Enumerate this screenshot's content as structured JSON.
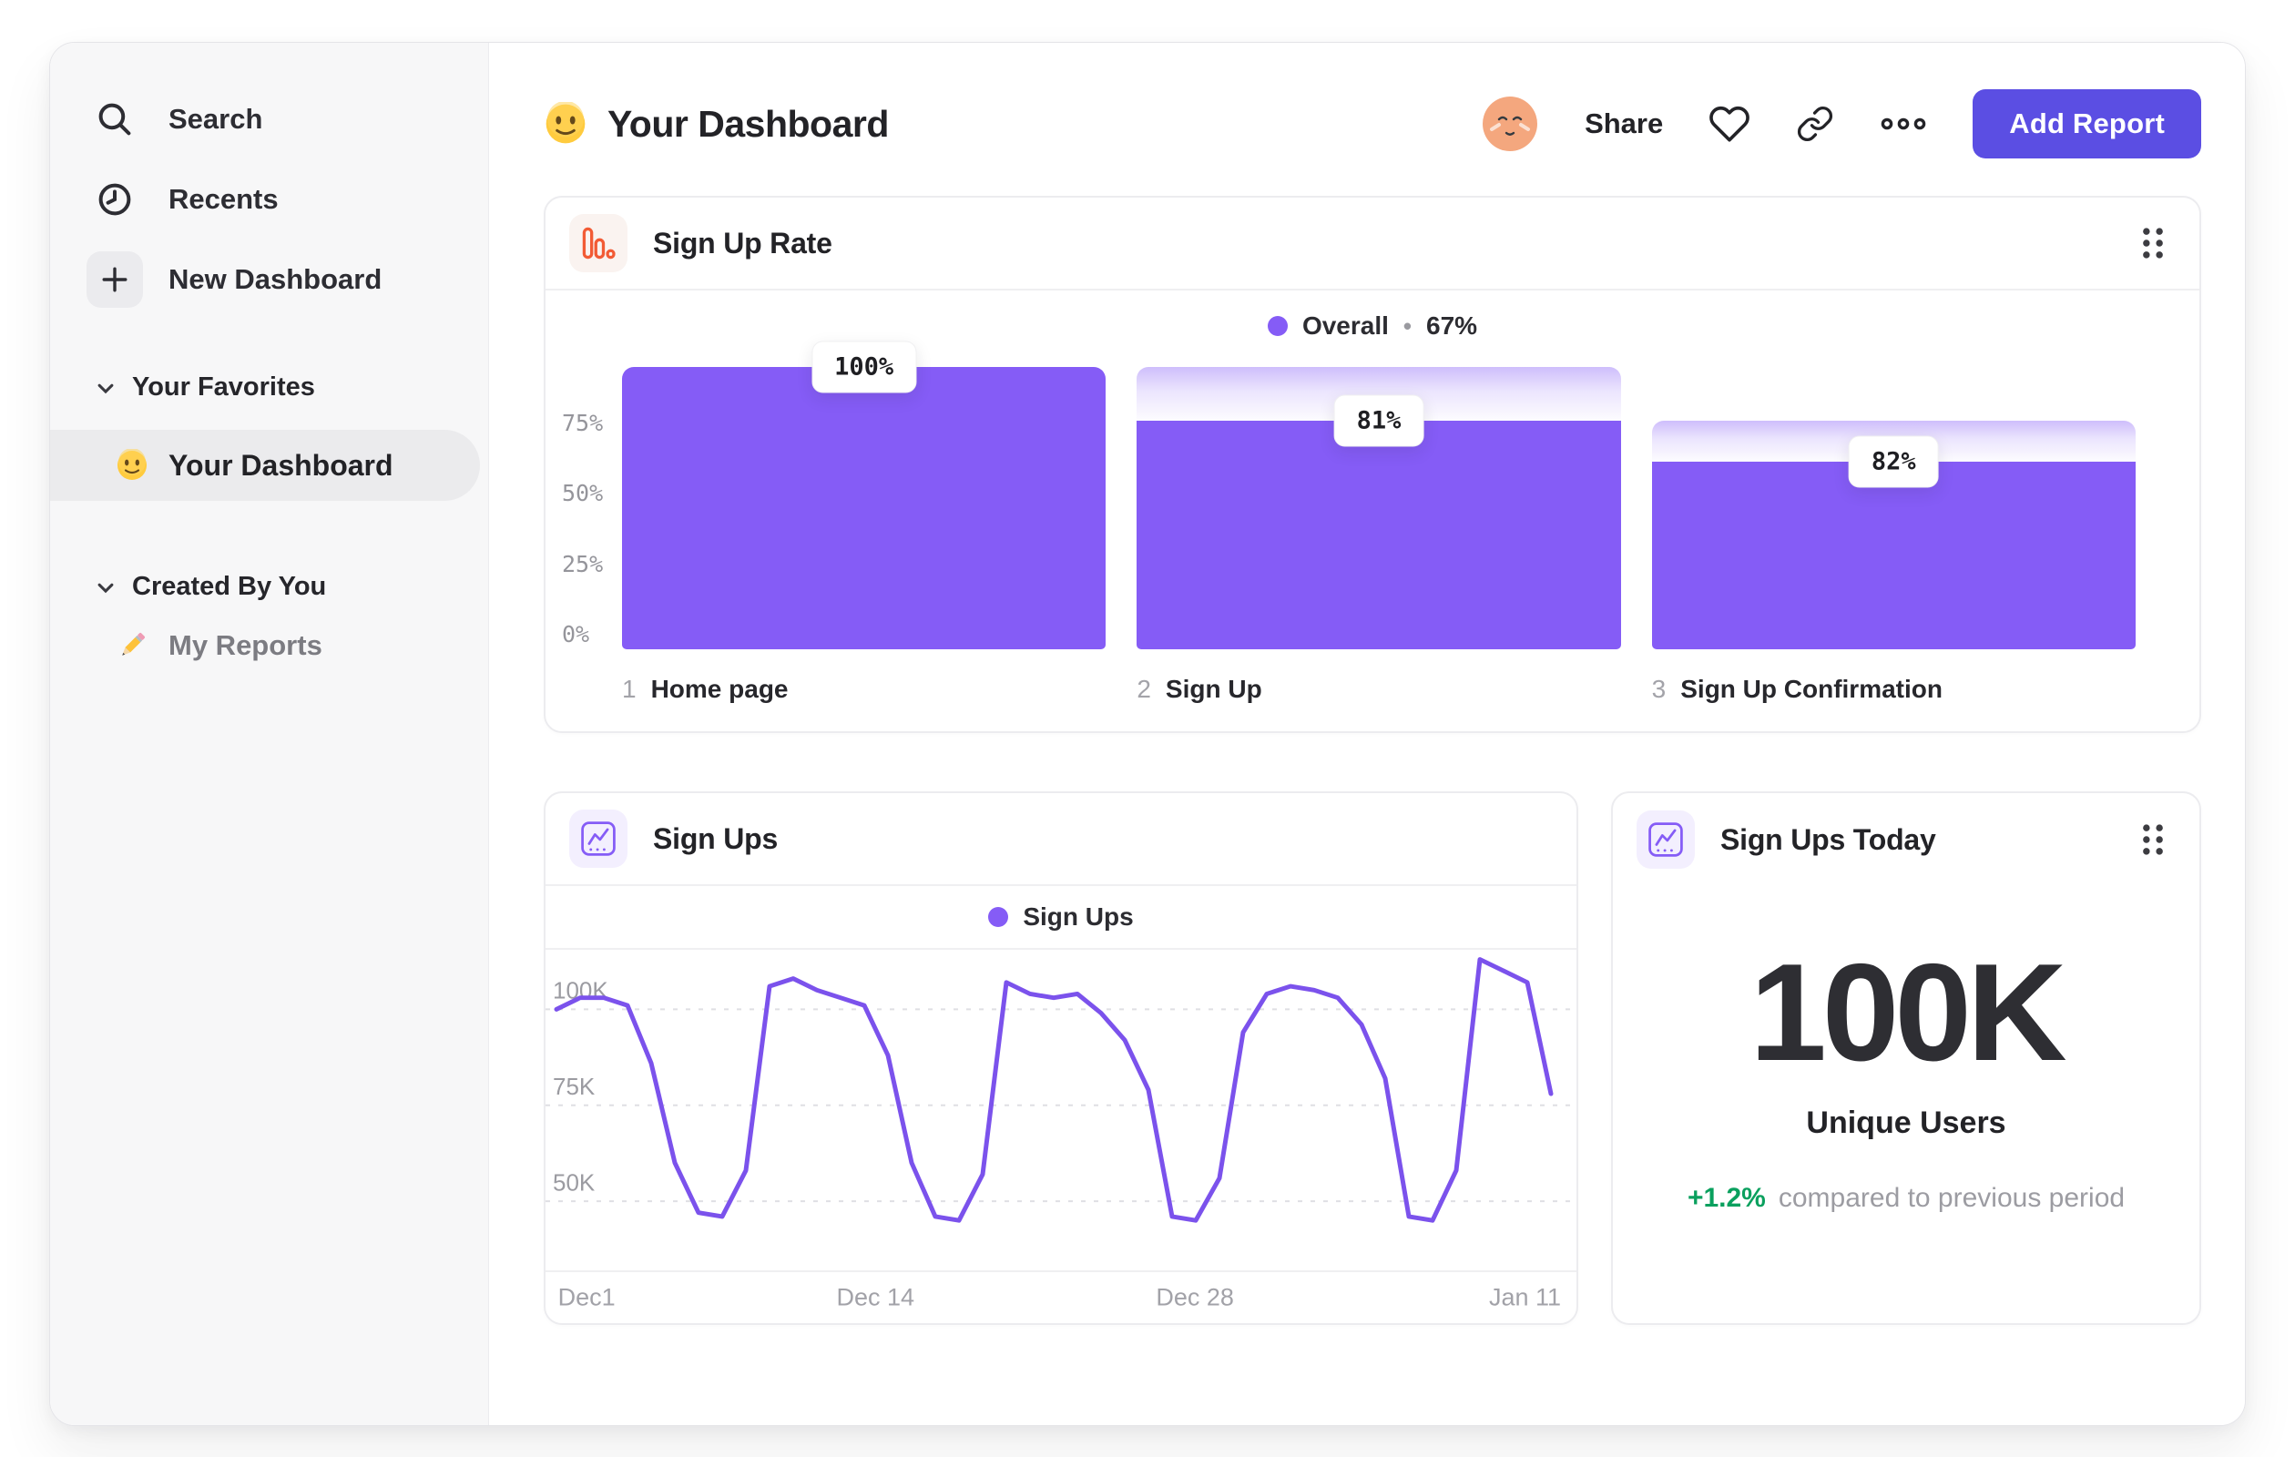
{
  "header": {
    "title": "Your Dashboard",
    "title_emoji": "slightly-smiling-face",
    "share_label": "Share",
    "add_report_label": "Add Report",
    "action_icons": [
      "avatar",
      "heart-icon",
      "link-icon",
      "more-icon"
    ]
  },
  "sidebar": {
    "items": [
      {
        "icon": "search-icon",
        "label": "Search"
      },
      {
        "icon": "clock-icon",
        "label": "Recents"
      },
      {
        "icon": "plus-icon",
        "label": "New Dashboard"
      }
    ],
    "sections": [
      {
        "label": "Your Favorites",
        "items": [
          {
            "icon": "smiley-emoji",
            "label": "Your Dashboard",
            "selected": true
          }
        ]
      },
      {
        "label": "Created By You",
        "items": [
          {
            "icon": "pencil-emoji",
            "label": "My Reports",
            "selected": false
          }
        ]
      }
    ]
  },
  "colors": {
    "accent_purple": "#855CF6",
    "line_purple": "#7B52EC",
    "button_purple": "#5B4EE3",
    "icon_orange": "#F25B35",
    "positive_green": "#0AA05E",
    "sidebar_bg": "#F7F7F8",
    "card_border": "#ECECEF"
  },
  "chart_data": [
    {
      "type": "bar",
      "subtype": "funnel",
      "title": "Sign Up Rate",
      "overall_label": "Overall",
      "separator": "•",
      "overall_value": "67%",
      "legend_position": "top-center",
      "grid": false,
      "ylim": [
        0,
        100
      ],
      "y_ticks": [
        {
          "label": "75%",
          "value": 75
        },
        {
          "label": "50%",
          "value": 50
        },
        {
          "label": "25%",
          "value": 25
        },
        {
          "label": "0%",
          "value": 0
        }
      ],
      "steps": [
        {
          "index": "1",
          "label": "Home page",
          "conversion_pct": 100,
          "badge": "100%"
        },
        {
          "index": "2",
          "label": "Sign Up",
          "conversion_pct": 81,
          "badge": "81%"
        },
        {
          "index": "3",
          "label": "Sign Up Confirmation",
          "conversion_pct": 82,
          "badge": "82%"
        }
      ]
    },
    {
      "type": "line",
      "title": "Sign Ups",
      "legend": "Sign Ups",
      "legend_position": "top-center",
      "grid": "dashed-horizontal",
      "unit": "K users per day",
      "ylim": [
        32,
        115.5
      ],
      "y_ticks": [
        {
          "label": "100K",
          "value": 100
        },
        {
          "label": "75K",
          "value": 75
        },
        {
          "label": "50K",
          "value": 50
        }
      ],
      "x_ticks": [
        {
          "label": "Dec1",
          "pos": 0.012,
          "align": "start"
        },
        {
          "label": "Dec 14",
          "pos": 0.32,
          "align": "center"
        },
        {
          "label": "Dec 28",
          "pos": 0.63,
          "align": "center"
        },
        {
          "label": "Jan 11",
          "pos": 0.985,
          "align": "end"
        }
      ],
      "series": [
        {
          "name": "Sign Ups",
          "values": [
            100,
            103,
            103,
            101,
            86,
            60,
            47,
            46,
            58,
            106,
            108,
            105,
            103,
            101,
            88,
            60,
            46,
            45,
            57,
            107,
            104,
            103,
            104,
            99,
            92,
            79,
            46,
            45,
            56,
            94,
            104,
            106,
            105,
            103,
            96,
            82,
            46,
            45,
            58,
            113,
            110,
            107,
            78
          ]
        }
      ]
    },
    {
      "type": "big-number",
      "title": "Sign Ups Today",
      "value": "100K",
      "label": "Unique Users",
      "delta": "+1.2%",
      "delta_caption": "compared to previous period"
    }
  ]
}
